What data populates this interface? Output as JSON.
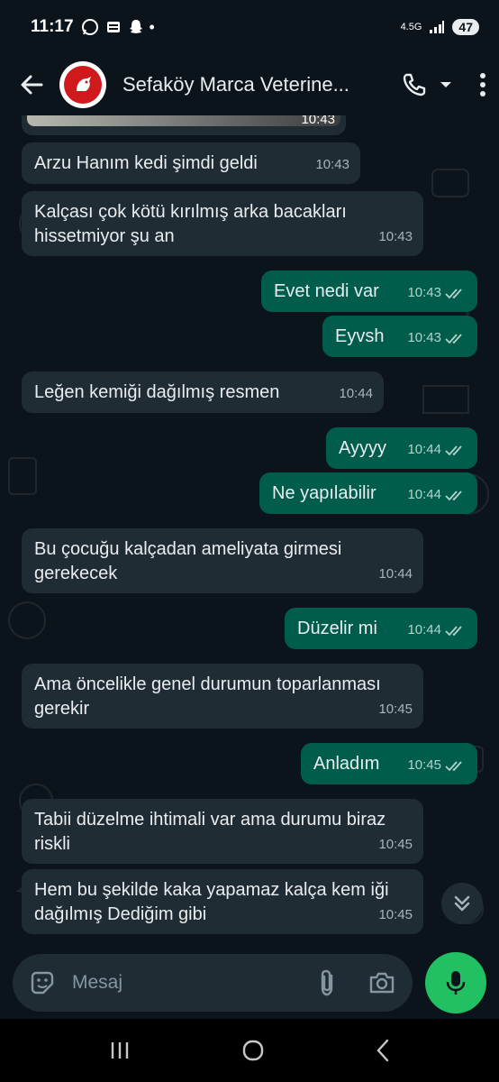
{
  "status_bar": {
    "time": "11:17",
    "network": "4.5G",
    "battery": "47"
  },
  "header": {
    "contact_name": "Sefaköy Marca Veterine..."
  },
  "messages": [
    {
      "direction": "in",
      "text": "",
      "time": "10:43"
    },
    {
      "direction": "in",
      "text": "Arzu Hanım kedi şimdi geldi",
      "time": "10:43"
    },
    {
      "direction": "in",
      "text": "Kalçası çok kötü kırılmış arka bacakları hissetmiyor şu an",
      "time": "10:43"
    },
    {
      "direction": "out",
      "text": "Evet nedi var",
      "time": "10:43"
    },
    {
      "direction": "out",
      "text": "Eyvsh",
      "time": "10:43"
    },
    {
      "direction": "in",
      "text": "Leğen kemiği dağılmış resmen",
      "time": "10:44"
    },
    {
      "direction": "out",
      "text": "Ayyyy",
      "time": "10:44"
    },
    {
      "direction": "out",
      "text": "Ne yapılabilir",
      "time": "10:44"
    },
    {
      "direction": "in",
      "text": "Bu çocuğu kalçadan ameliyata girmesi gerekecek",
      "time": "10:44"
    },
    {
      "direction": "out",
      "text": "Düzelir mi",
      "time": "10:44"
    },
    {
      "direction": "in",
      "text": "Ama öncelikle genel durumun toparlanması gerekir",
      "time": "10:45"
    },
    {
      "direction": "out",
      "text": "Anladım",
      "time": "10:45"
    },
    {
      "direction": "in",
      "text": "Tabii düzelme ihtimali var ama durumu biraz riskli",
      "time": "10:45"
    },
    {
      "direction": "in",
      "text": "Hem bu şekilde kaka yapamaz kalça kem iği dağılmış Dediğim gibi",
      "time": "10:45"
    }
  ],
  "composer": {
    "placeholder": "Mesaj"
  },
  "colors": {
    "background": "#0b141a",
    "incoming_bubble": "#202c33",
    "outgoing_bubble": "#005c4b",
    "accent_green": "#21c063",
    "read_tick": "#b3d4cc"
  },
  "icons": [
    "back-arrow-icon",
    "phone-icon",
    "dropdown-caret-icon",
    "more-vert-icon",
    "chevron-double-down-icon",
    "sticker-icon",
    "attach-icon",
    "camera-icon",
    "mic-icon",
    "recents-icon",
    "home-icon",
    "back-icon"
  ]
}
